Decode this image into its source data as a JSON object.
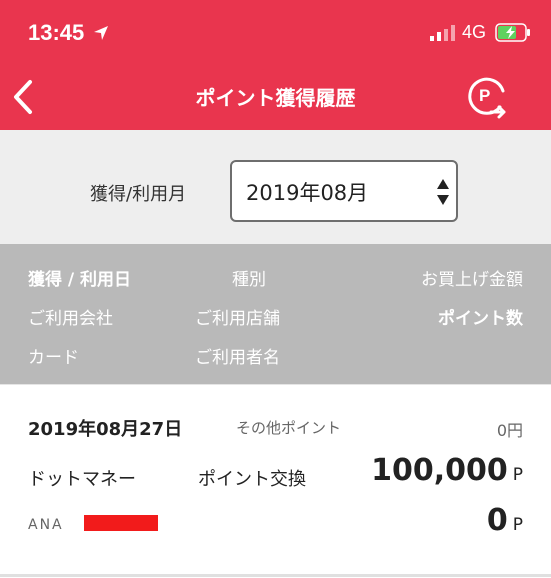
{
  "status_bar": {
    "time": "13:45",
    "network": "4G"
  },
  "nav": {
    "title": "ポイント獲得履歴",
    "p_icon_label": "P"
  },
  "filter": {
    "label": "獲得/利用月",
    "selected_month": "2019年08月"
  },
  "legend": {
    "row1": [
      "獲得 / 利用日",
      "種別",
      "お買上げ金額"
    ],
    "row2": [
      "ご利用会社",
      "ご利用店舗",
      "ポイント数"
    ],
    "row3": [
      "カード",
      "ご利用者名"
    ]
  },
  "entries": [
    {
      "date": "2019年08月27日",
      "type": "その他ポイント",
      "amount": "0円",
      "company": "ドットマネー",
      "store": "ポイント交換",
      "points": "100,000",
      "points_unit": "P",
      "card": "ANA",
      "user_points": "0",
      "user_points_unit": "P"
    }
  ],
  "colors": {
    "header": "#e9354e",
    "filter_bg": "#eeeeee",
    "legend_bg": "#b9b9b9",
    "redaction": "#f21b1b"
  },
  "icons": {
    "back": "chevron-left-icon",
    "points_history": "p-circle-arrow-icon",
    "location": "location-arrow-icon",
    "signal": "signal-bars-icon",
    "battery": "battery-charging-icon",
    "select": "up-down-arrows-icon"
  }
}
